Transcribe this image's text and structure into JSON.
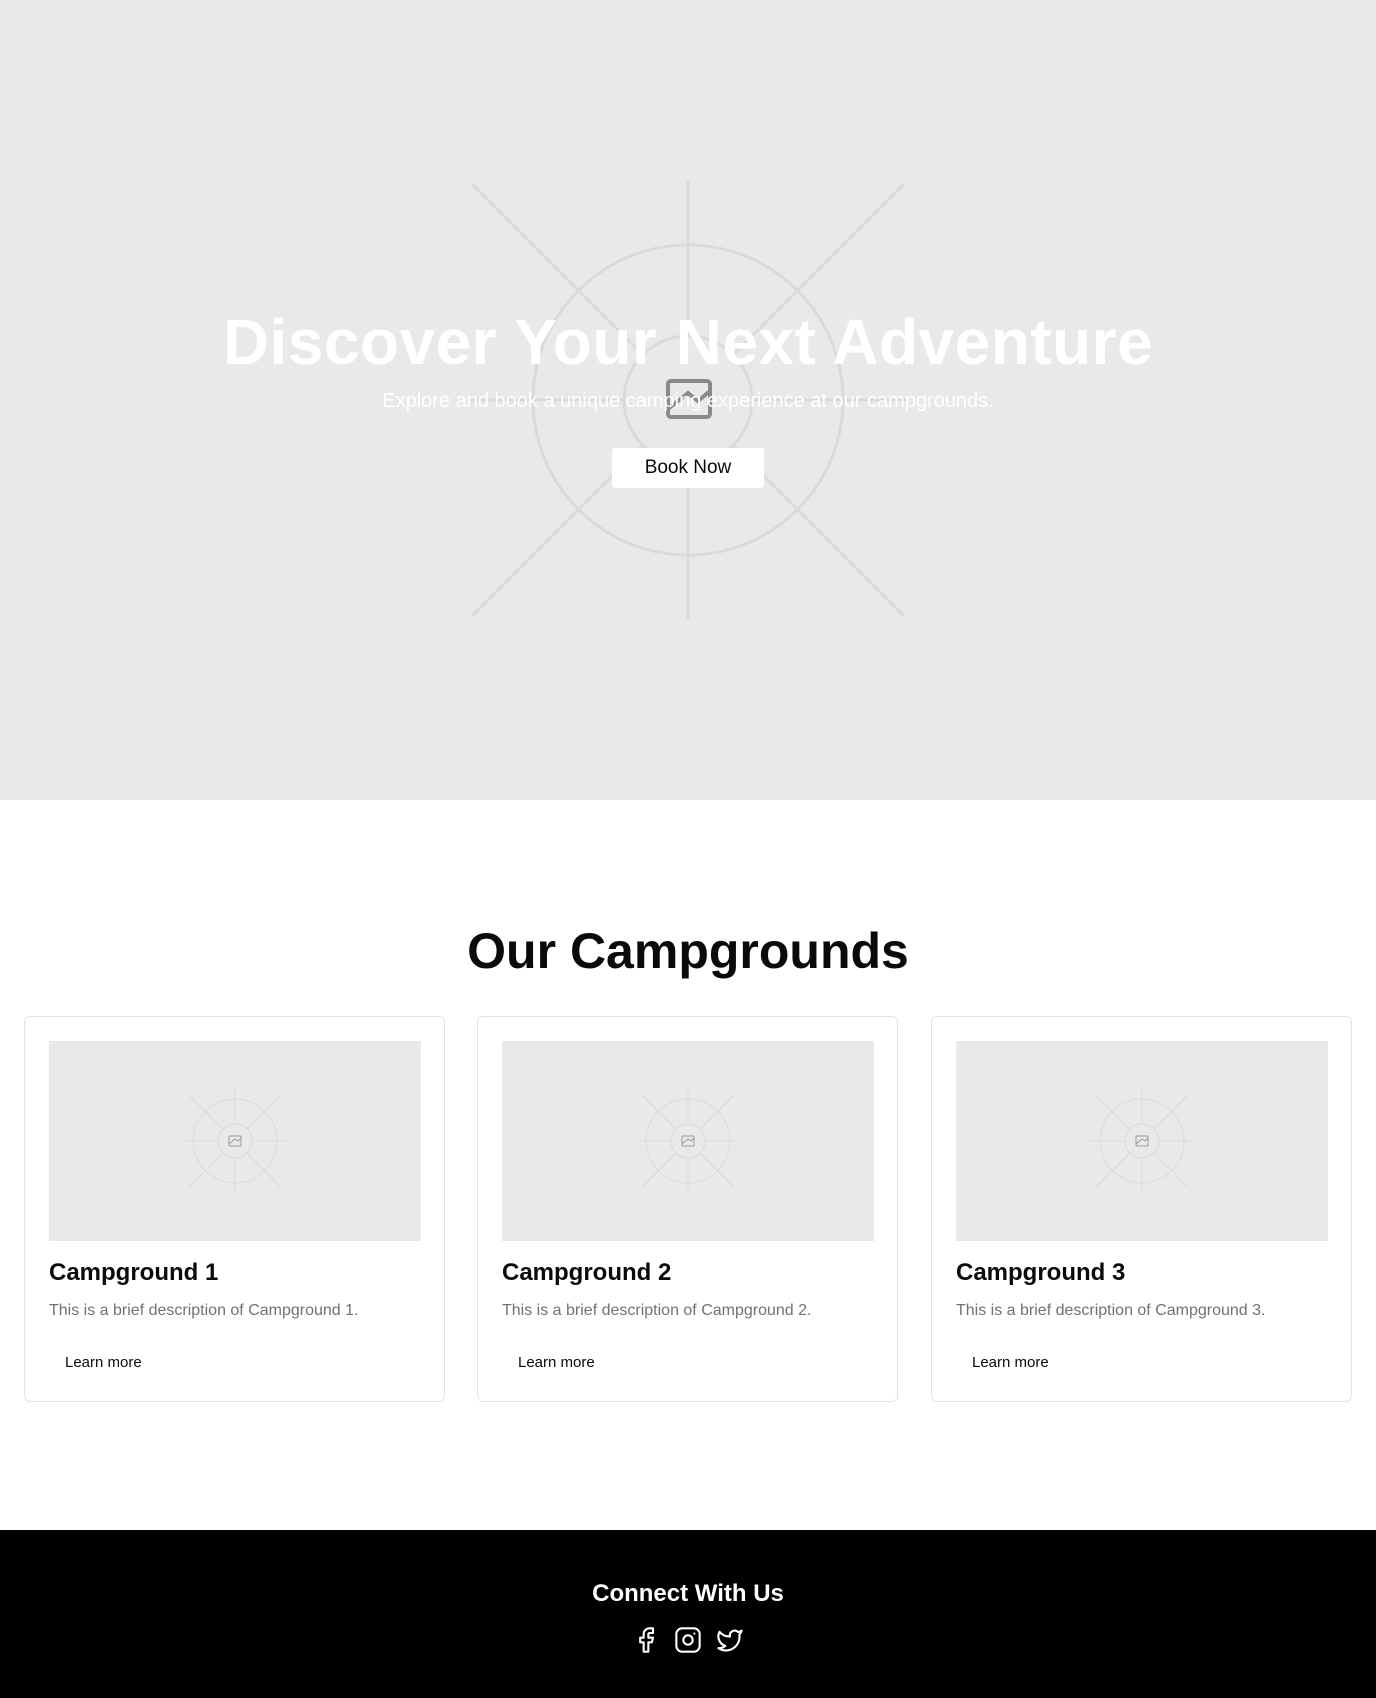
{
  "hero": {
    "title": "Discover Your Next Adventure",
    "subtitle": "Explore and book a unique camping experience at our campgrounds.",
    "cta_label": "Book Now",
    "placeholder_icon": "image-placeholder-icon"
  },
  "campgrounds": {
    "title": "Our Campgrounds",
    "items": [
      {
        "title": "Campground 1",
        "description": "This is a brief description of Campground 1.",
        "link_label": "Learn more"
      },
      {
        "title": "Campground 2",
        "description": "This is a brief description of Campground 2.",
        "link_label": "Learn more"
      },
      {
        "title": "Campground 3",
        "description": "This is a brief description of Campground 3.",
        "link_label": "Learn more"
      }
    ]
  },
  "footer": {
    "title": "Connect With Us",
    "socials": [
      {
        "icon": "facebook-icon"
      },
      {
        "icon": "instagram-icon"
      },
      {
        "icon": "twitter-icon"
      }
    ]
  },
  "colors": {
    "placeholder_bg": "#e9e9e9",
    "footer_bg": "#000000",
    "text_muted": "#71717a",
    "card_border": "#e4e4e7"
  }
}
